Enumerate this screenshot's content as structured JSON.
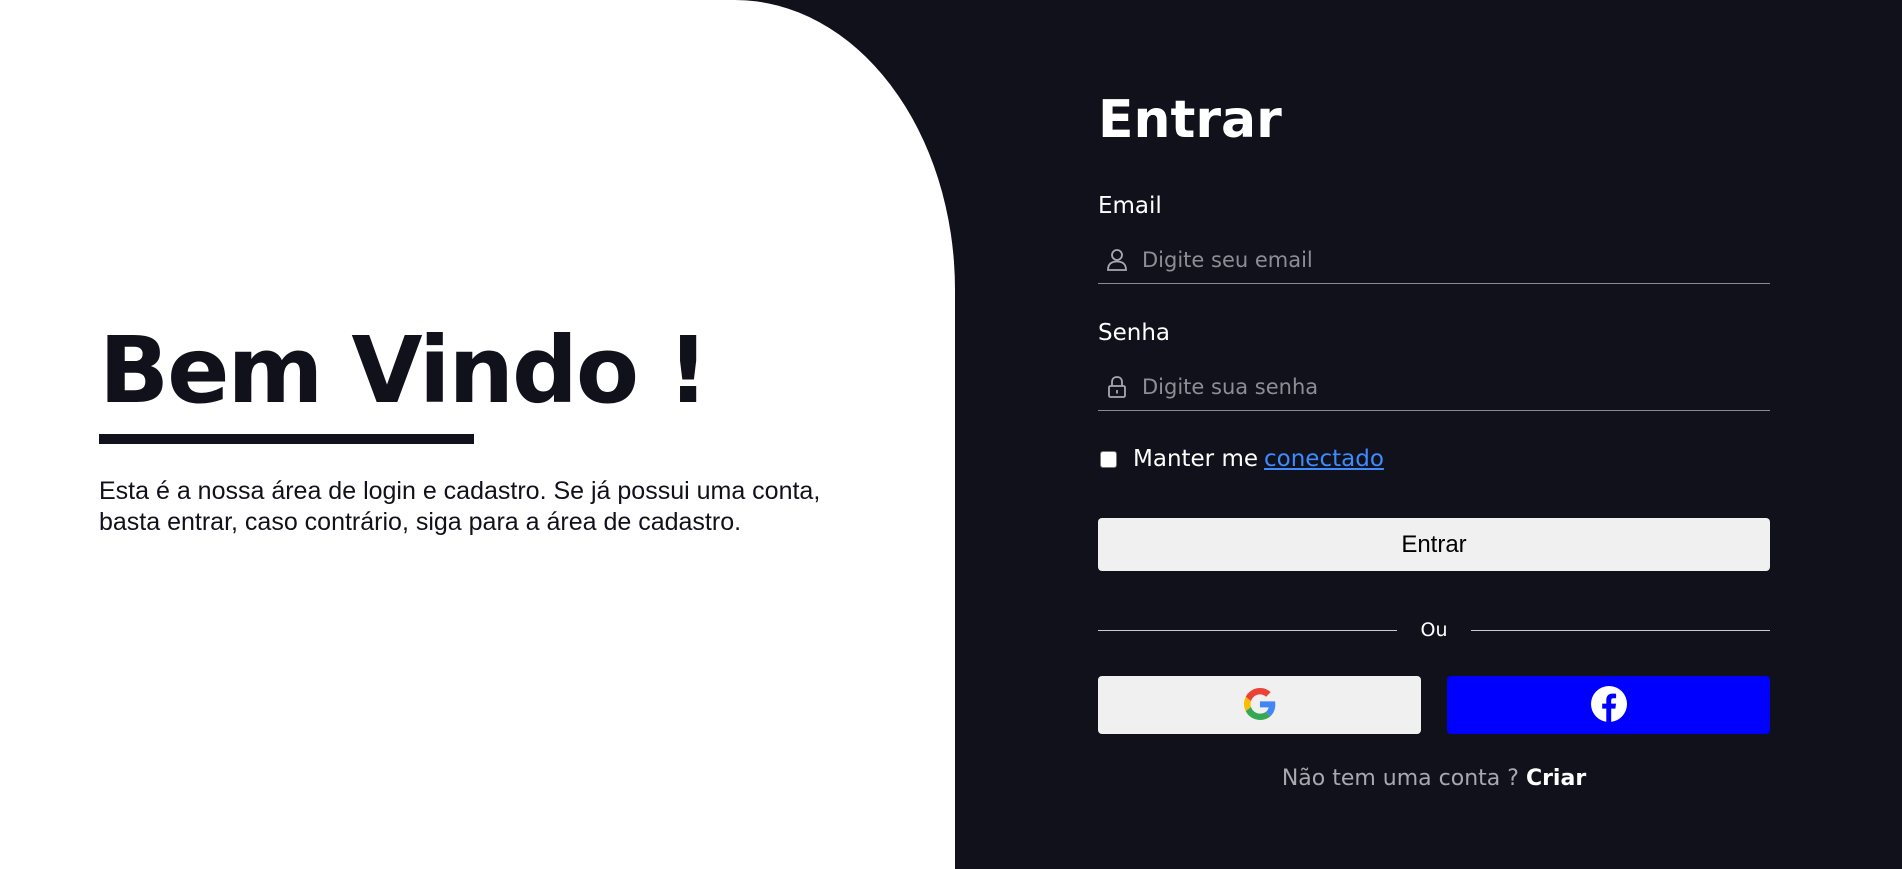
{
  "welcome": {
    "title": "Bem Vindo !",
    "description": "Esta é a nossa área de login e cadastro. Se já possui uma conta, basta entrar, caso contrário, siga para a área de cadastro."
  },
  "login": {
    "title": "Entrar",
    "email_label": "Email",
    "email_placeholder": "Digite seu email",
    "email_icon": "user-icon",
    "password_label": "Senha",
    "password_placeholder": "Digite sua senha",
    "password_icon": "lock-icon",
    "remember_text": "Manter me",
    "remember_link": "conectado",
    "remember_checked": false,
    "submit_label": "Entrar",
    "divider_text": "Ou",
    "social": [
      {
        "name": "google",
        "icon": "google-icon",
        "color": "#f0f0f0"
      },
      {
        "name": "facebook",
        "icon": "facebook-icon",
        "color": "#0000ff"
      }
    ],
    "signup_text": "Não tem uma conta ?",
    "signup_link": "Criar"
  },
  "colors": {
    "dark_bg": "#11111b",
    "light_bg": "#ffffff",
    "link": "#3d8bff",
    "facebook": "#0000ff"
  }
}
